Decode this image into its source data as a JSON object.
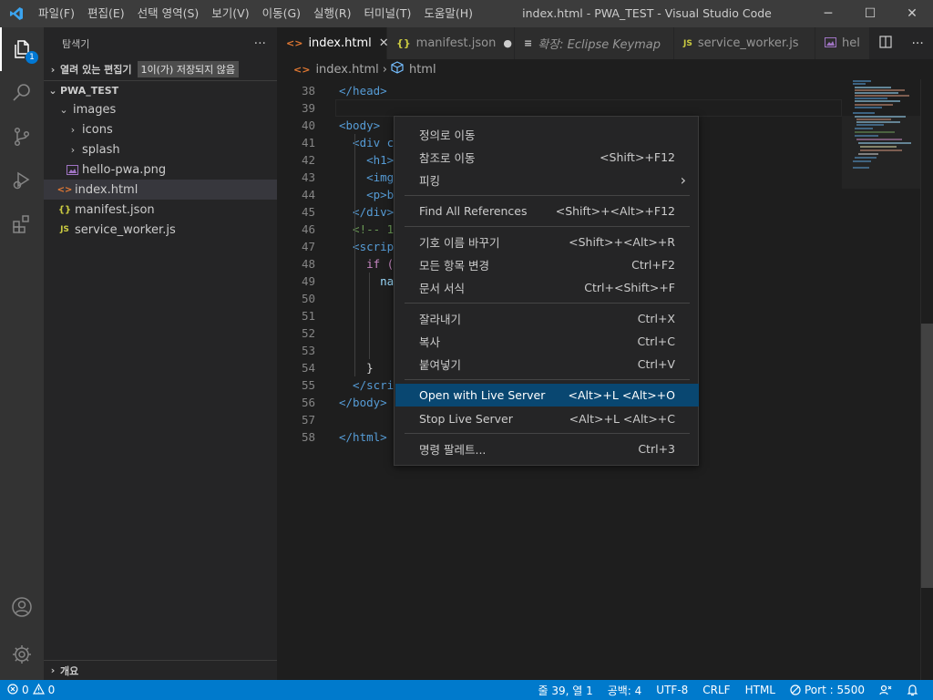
{
  "window": {
    "title": "index.html - PWA_TEST - Visual Studio Code",
    "menu": [
      "파일(F)",
      "편집(E)",
      "선택 영역(S)",
      "보기(V)",
      "이동(G)",
      "실행(R)",
      "터미널(T)",
      "도움말(H)"
    ],
    "controls": {
      "minimize": "─",
      "maximize": "☐",
      "close": "✕"
    }
  },
  "activity_bar": {
    "explorer_badge": "1"
  },
  "sidebar": {
    "header": "탐색기",
    "more": "···",
    "open_editors": {
      "label": "열려 있는 편집기",
      "tag": "1이(가) 저장되지 않음"
    },
    "project": {
      "label": "PWA_TEST"
    },
    "tree": {
      "images": "images",
      "icons": "icons",
      "splash": "splash",
      "hello_pwa": "hello-pwa.png",
      "index": "index.html",
      "manifest": "manifest.json",
      "service_worker": "service_worker.js"
    },
    "outline": "개요"
  },
  "tabs": {
    "t1": {
      "label": "index.html",
      "close": "✕"
    },
    "t2": {
      "label": "manifest.json",
      "dot": "●"
    },
    "t3": {
      "label": "확장: Eclipse Keymap"
    },
    "t4": {
      "label": "service_worker.js"
    },
    "t5": {
      "label": "hel"
    }
  },
  "breadcrumb": {
    "file": "index.html",
    "sep": "›",
    "node": "html"
  },
  "editor": {
    "lines": [
      {
        "n": "38",
        "text": "</head>"
      },
      {
        "n": "39",
        "text": ""
      },
      {
        "n": "40",
        "text": "<body>"
      },
      {
        "n": "41",
        "text": "  <div c"
      },
      {
        "n": "42",
        "text": "    <h1>"
      },
      {
        "n": "43",
        "text": "    <img"
      },
      {
        "n": "44",
        "text": "    <p>b"
      },
      {
        "n": "45",
        "text": "  </div>"
      },
      {
        "n": "46",
        "text": "  <!-- 1"
      },
      {
        "n": "47",
        "text": "  <scrip"
      },
      {
        "n": "48",
        "text": "    if ("
      },
      {
        "n": "49",
        "text": "      na"
      },
      {
        "n": "50",
        "text": ""
      },
      {
        "n": "51",
        "text": ""
      },
      {
        "n": "52",
        "text": ""
      },
      {
        "n": "53",
        "text": ""
      },
      {
        "n": "54",
        "text": "    }"
      },
      {
        "n": "55",
        "text": "  </scri"
      },
      {
        "n": "56",
        "text": "</body>"
      },
      {
        "n": "57",
        "text": ""
      },
      {
        "n": "58",
        "text": "</html>"
      }
    ]
  },
  "context_menu": {
    "items": [
      {
        "label": "정의로 이동",
        "shortcut": ""
      },
      {
        "label": "참조로 이동",
        "shortcut": "<Shift>+F12"
      },
      {
        "label": "피킹",
        "shortcut": "›"
      },
      {
        "label": "Find All References",
        "shortcut": "<Shift>+<Alt>+F12"
      },
      {
        "label": "기호 이름 바꾸기",
        "shortcut": "<Shift>+<Alt>+R"
      },
      {
        "label": "모든 항목 변경",
        "shortcut": "Ctrl+F2"
      },
      {
        "label": "문서 서식",
        "shortcut": "Ctrl+<Shift>+F"
      },
      {
        "label": "잘라내기",
        "shortcut": "Ctrl+X"
      },
      {
        "label": "복사",
        "shortcut": "Ctrl+C"
      },
      {
        "label": "붙여넣기",
        "shortcut": "Ctrl+V"
      },
      {
        "label": "Open with Live Server",
        "shortcut": "<Alt>+L <Alt>+O"
      },
      {
        "label": "Stop Live Server",
        "shortcut": "<Alt>+L <Alt>+C"
      },
      {
        "label": "명령 팔레트...",
        "shortcut": "Ctrl+3"
      }
    ]
  },
  "statusbar": {
    "errors": "0",
    "warnings": "0",
    "position": "줄 39, 열 1",
    "spaces": "공백: 4",
    "encoding": "UTF-8",
    "eol": "CRLF",
    "language": "HTML",
    "port": "Port : 5500"
  },
  "colors": {
    "accent": "#007acc",
    "menu_highlight": "#094771",
    "html_icon": "#e37933",
    "json_icon": "#cbcb41",
    "image_icon": "#a074c4"
  }
}
